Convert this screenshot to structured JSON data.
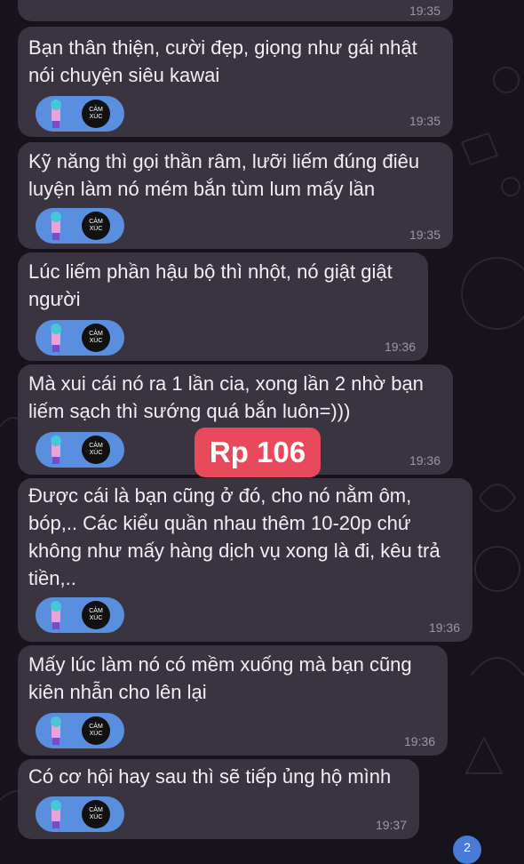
{
  "reaction_label": {
    "line1": "CẢM",
    "line2": "XÚC"
  },
  "messages": [
    {
      "text": "",
      "time": "19:35"
    },
    {
      "text": "Bạn thân thiện, cười đẹp, giọng như gái nhật nói chuyện siêu kawai",
      "time": "19:35"
    },
    {
      "text": "Kỹ năng thì gọi thần râm, lưỡi liếm đúng điêu luyện làm nó mém bắn tùm lum mấy lần",
      "time": "19:35"
    },
    {
      "text": "Lúc liếm phần hậu bộ thì nhột, nó giật giật người",
      "time": "19:36"
    },
    {
      "text": "Mà xui cái nó ra 1 lần cia, xong lần 2 nhờ bạn liếm sạch thì sướng quá bắn luôn=)))",
      "time": "19:36"
    },
    {
      "text": "Được cái là bạn cũng ở đó, cho nó nằm ôm, bóp,.. Các kiểu quần nhau thêm 10-20p chứ không như mấy hàng dịch vụ xong là đi, kêu trả tiền,..",
      "time": "19:36"
    },
    {
      "text": "Mấy lúc làm nó có mềm xuống mà bạn cũng kiên nhẫn cho lên lại",
      "time": "19:36"
    },
    {
      "text": "Có cơ hội hay sau thì sẽ tiếp ủng hộ mình",
      "time": "19:37"
    }
  ],
  "watermark": "Rp 106",
  "scroll_badge": "2",
  "colors": {
    "bubble": "#3a3440",
    "reaction": "#5a8fe0",
    "tag": "#e8495b",
    "background": "#17131c"
  }
}
